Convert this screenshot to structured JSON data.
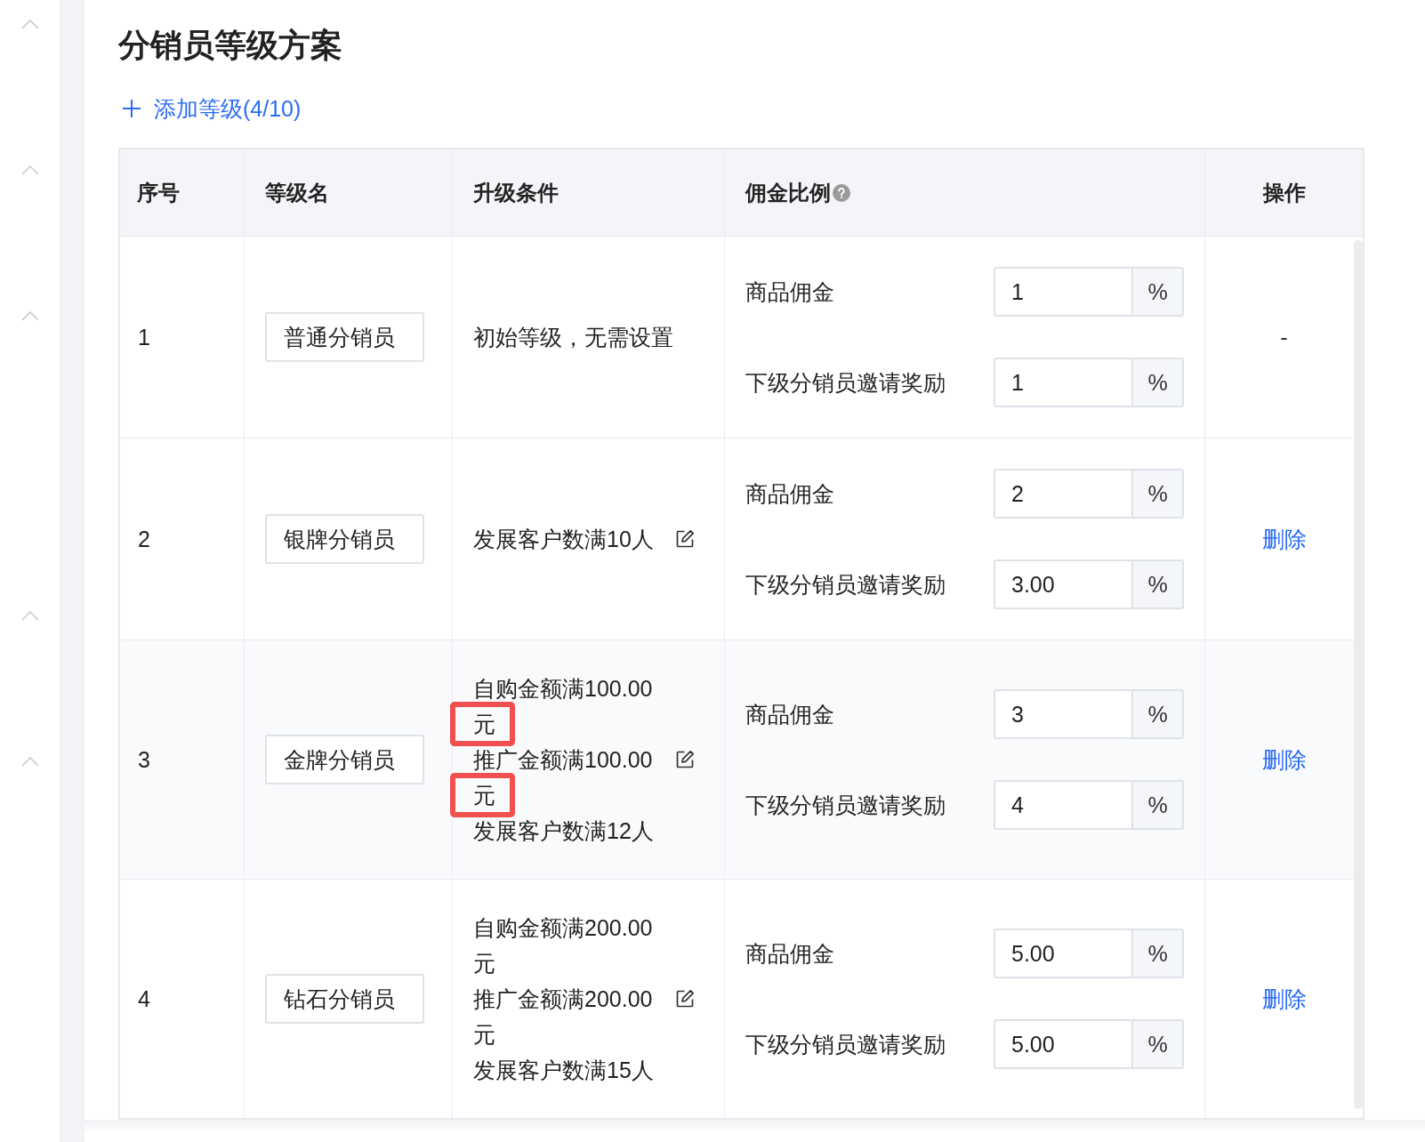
{
  "page": {
    "title": "分销员等级方案"
  },
  "add_level_button": {
    "label": "添加等级(4/10)"
  },
  "table": {
    "columns": [
      {
        "label": "序号",
        "help": false
      },
      {
        "label": "等级名",
        "help": false
      },
      {
        "label": "升级条件",
        "help": false
      },
      {
        "label": "佣金比例",
        "help": true
      },
      {
        "label": "操作",
        "help": false
      }
    ],
    "rows": [
      {
        "index": "1",
        "level_name": "普通分销员",
        "hovered": false,
        "editable": false,
        "conditions": [
          {
            "text": "初始等级，无需设置"
          }
        ],
        "commissions": [
          {
            "label": "商品佣金",
            "value": "1",
            "unit": "%"
          },
          {
            "label": "下级分销员邀请奖励",
            "value": "1",
            "unit": "%"
          }
        ],
        "action": {
          "kind": "text",
          "label": "-"
        }
      },
      {
        "index": "2",
        "level_name": "银牌分销员",
        "hovered": false,
        "editable": true,
        "conditions": [
          {
            "text": "发展客户数满10人"
          }
        ],
        "commissions": [
          {
            "label": "商品佣金",
            "value": "2",
            "unit": "%"
          },
          {
            "label": "下级分销员邀请奖励",
            "value": "3.00",
            "unit": "%"
          }
        ],
        "action": {
          "kind": "link",
          "label": "删除"
        }
      },
      {
        "index": "3",
        "level_name": "金牌分销员",
        "hovered": true,
        "editable": true,
        "conditions": [
          {
            "text": "自购金额满100.00",
            "unit": {
              "text": "元",
              "marked": true
            }
          },
          {
            "text": "推广金额满100.00",
            "unit": {
              "text": "元",
              "marked": true
            }
          },
          {
            "text": "发展客户数满12人"
          }
        ],
        "commissions": [
          {
            "label": "商品佣金",
            "value": "3",
            "unit": "%"
          },
          {
            "label": "下级分销员邀请奖励",
            "value": "4",
            "unit": "%"
          }
        ],
        "action": {
          "kind": "link",
          "label": "删除"
        }
      },
      {
        "index": "4",
        "level_name": "钻石分销员",
        "hovered": false,
        "editable": true,
        "conditions": [
          {
            "text": "自购金额满200.00",
            "unit": {
              "text": "元",
              "marked": false
            }
          },
          {
            "text": "推广金额满200.00",
            "unit": {
              "text": "元",
              "marked": false
            }
          },
          {
            "text": "发展客户数满15人"
          }
        ],
        "commissions": [
          {
            "label": "商品佣金",
            "value": "5.00",
            "unit": "%"
          },
          {
            "label": "下级分销员邀请奖励",
            "value": "5.00",
            "unit": "%"
          }
        ],
        "action": {
          "kind": "link",
          "label": "删除"
        }
      }
    ]
  }
}
